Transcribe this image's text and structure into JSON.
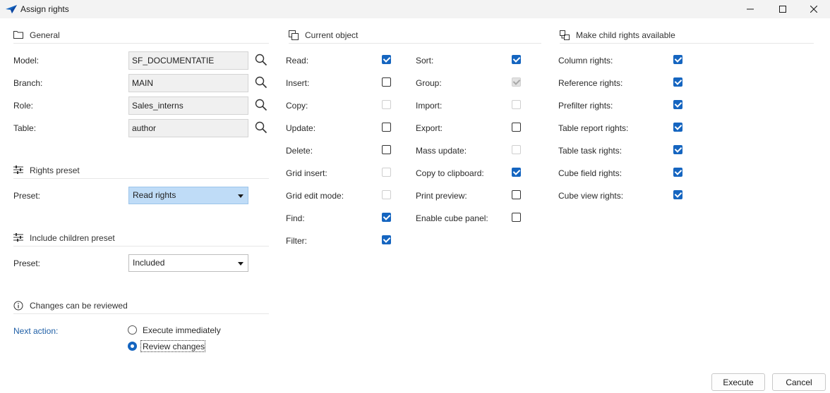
{
  "window": {
    "title": "Assign rights",
    "accent_color": "#1565c0"
  },
  "general": {
    "heading": "General",
    "fields": [
      {
        "label": "Model:",
        "value": "SF_DOCUMENTATIE"
      },
      {
        "label": "Branch:",
        "value": "MAIN"
      },
      {
        "label": "Role:",
        "value": "Sales_interns"
      },
      {
        "label": "Table:",
        "value": "author"
      }
    ]
  },
  "rights_preset": {
    "heading": "Rights preset",
    "label": "Preset:",
    "value": "Read rights"
  },
  "children_preset": {
    "heading": "Include children preset",
    "label": "Preset:",
    "value": "Included"
  },
  "review": {
    "heading": "Changes can be reviewed",
    "label": "Next action:",
    "options": [
      {
        "label": "Execute immediately",
        "selected": false
      },
      {
        "label": "Review changes",
        "selected": true
      }
    ]
  },
  "current_object": {
    "heading": "Current object",
    "left": [
      {
        "label": "Read:",
        "checked": true,
        "enabled": true
      },
      {
        "label": "Insert:",
        "checked": false,
        "enabled": true
      },
      {
        "label": "Copy:",
        "checked": false,
        "enabled": false
      },
      {
        "label": "Update:",
        "checked": false,
        "enabled": true
      },
      {
        "label": "Delete:",
        "checked": false,
        "enabled": true
      },
      {
        "label": "Grid insert:",
        "checked": false,
        "enabled": false
      },
      {
        "label": "Grid edit mode:",
        "checked": false,
        "enabled": false
      },
      {
        "label": "Find:",
        "checked": true,
        "enabled": true
      },
      {
        "label": "Filter:",
        "checked": true,
        "enabled": true
      }
    ],
    "right": [
      {
        "label": "Sort:",
        "checked": true,
        "enabled": true
      },
      {
        "label": "Group:",
        "checked": true,
        "enabled": false
      },
      {
        "label": "Import:",
        "checked": false,
        "enabled": false
      },
      {
        "label": "Export:",
        "checked": false,
        "enabled": true
      },
      {
        "label": "Mass update:",
        "checked": false,
        "enabled": false
      },
      {
        "label": "Copy to clipboard:",
        "checked": true,
        "enabled": true
      },
      {
        "label": "Print preview:",
        "checked": false,
        "enabled": true
      },
      {
        "label": "Enable cube panel:",
        "checked": false,
        "enabled": true
      }
    ]
  },
  "child_rights": {
    "heading": "Make child rights available",
    "items": [
      {
        "label": "Column rights:",
        "checked": true
      },
      {
        "label": "Reference rights:",
        "checked": true
      },
      {
        "label": "Prefilter rights:",
        "checked": true
      },
      {
        "label": "Table report rights:",
        "checked": true
      },
      {
        "label": "Table task rights:",
        "checked": true
      },
      {
        "label": "Cube field rights:",
        "checked": true
      },
      {
        "label": "Cube view rights:",
        "checked": true
      }
    ]
  },
  "buttons": {
    "execute": "Execute",
    "cancel": "Cancel"
  }
}
